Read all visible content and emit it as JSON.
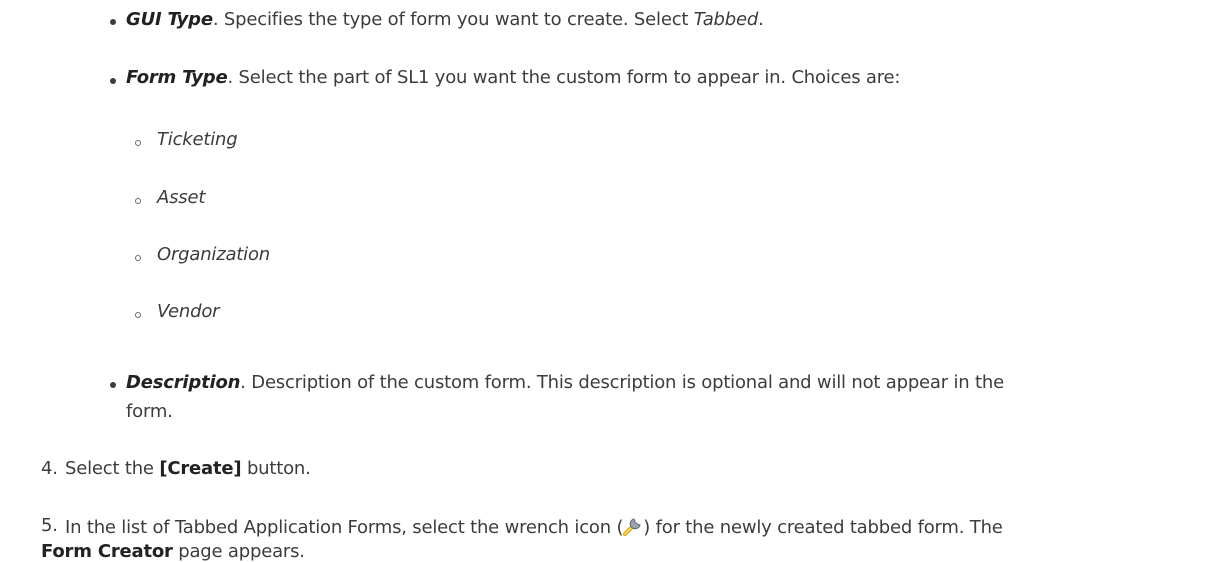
{
  "doc": {
    "gui_type": {
      "term": "GUI Type",
      "text_before": ". Specifies the type of form you want to create. Select ",
      "value": "Tabbed",
      "text_after": "."
    },
    "form_type": {
      "term": "Form Type",
      "text": ". Select the part of SL1 you want the custom form to appear in. Choices are:",
      "choices": [
        "Ticketing",
        "Asset",
        "Organization",
        "Vendor"
      ]
    },
    "description": {
      "term": "Description",
      "text_line1": ". Description of the custom form. This description is optional and will not appear in the",
      "text_line2": "form."
    },
    "step4": {
      "number": "4.",
      "text_before": "Select the ",
      "button": "[Create]",
      "text_after": " button."
    },
    "step5": {
      "number": "5.",
      "text_before": "In the list of Tabbed Application Forms, select the wrench icon (",
      "text_after": ") for the newly created tabbed form. The",
      "page_name": "Form Creator",
      "text_end": " page appears."
    }
  }
}
